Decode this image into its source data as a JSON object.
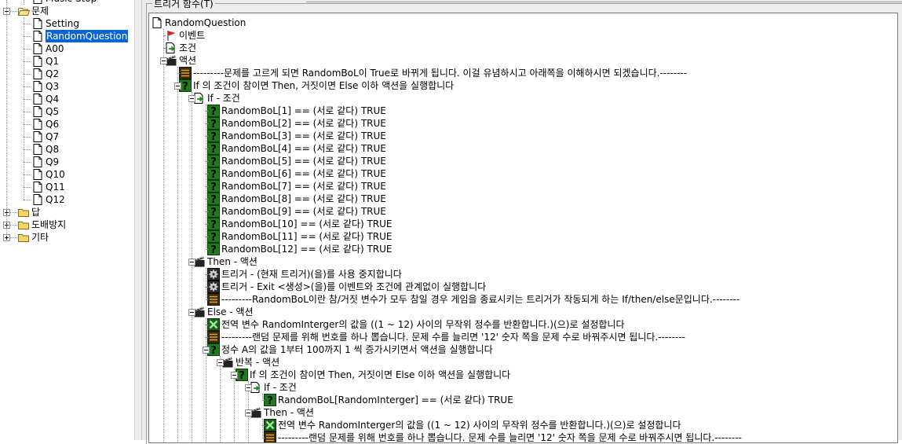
{
  "left_tree": [
    {
      "label": "Music Stop",
      "icon": "page-icon",
      "indent": 2,
      "partial": true
    },
    {
      "label": "문제",
      "icon": "open-folder-icon",
      "indent": 1,
      "expanded": true
    },
    {
      "label": "Setting",
      "icon": "page-icon",
      "indent": 2
    },
    {
      "label": "RandomQuestion",
      "icon": "page-icon",
      "indent": 2,
      "selected": true
    },
    {
      "label": "A00",
      "icon": "page-icon",
      "indent": 2
    },
    {
      "label": "Q1",
      "icon": "page-icon",
      "indent": 2
    },
    {
      "label": "Q2",
      "icon": "page-icon",
      "indent": 2
    },
    {
      "label": "Q3",
      "icon": "page-icon",
      "indent": 2
    },
    {
      "label": "Q4",
      "icon": "page-icon",
      "indent": 2
    },
    {
      "label": "Q5",
      "icon": "page-icon",
      "indent": 2
    },
    {
      "label": "Q6",
      "icon": "page-icon",
      "indent": 2
    },
    {
      "label": "Q7",
      "icon": "page-icon",
      "indent": 2
    },
    {
      "label": "Q8",
      "icon": "page-icon",
      "indent": 2
    },
    {
      "label": "Q9",
      "icon": "page-icon",
      "indent": 2
    },
    {
      "label": "Q10",
      "icon": "page-icon",
      "indent": 2
    },
    {
      "label": "Q11",
      "icon": "page-icon",
      "indent": 2
    },
    {
      "label": "Q12",
      "icon": "page-icon",
      "indent": 2
    },
    {
      "label": "답",
      "icon": "folder-icon",
      "indent": 1,
      "collapsed": true
    },
    {
      "label": "도배방지",
      "icon": "folder-icon",
      "indent": 1,
      "collapsed": true
    },
    {
      "label": "기타",
      "icon": "folder-icon",
      "indent": 1,
      "collapsed": true
    }
  ],
  "panel_title": "트리거 함수(T)",
  "trigger_tree": [
    {
      "label": "RandomQuestion",
      "icon": "page-icon",
      "depth": 0
    },
    {
      "label": "이벤트",
      "icon": "flag-icon",
      "depth": 1
    },
    {
      "label": "조건",
      "icon": "condition-icon",
      "depth": 1
    },
    {
      "label": "액션",
      "icon": "action-icon",
      "depth": 1,
      "toggle": "minus"
    },
    {
      "label": "---------문제를 고르게 되면 RandomBoL이 True로 바뀌게 됩니다. 이걸 유념하시고 아래쪽을 이해하시면 되겠습니다.--------",
      "icon": "comment-icon",
      "depth": 2
    },
    {
      "label": "If 의 조건이 참이면 Then, 거짓이면 Else 이하 액션을 실행합니다",
      "icon": "question-icon",
      "depth": 2,
      "toggle": "minus"
    },
    {
      "label": "If - 조건",
      "icon": "condition-icon",
      "depth": 3,
      "toggle": "minus"
    },
    {
      "label": "RandomBoL[1] == (서로 같다) TRUE",
      "icon": "question-icon",
      "depth": 4
    },
    {
      "label": "RandomBoL[2] == (서로 같다) TRUE",
      "icon": "question-icon",
      "depth": 4
    },
    {
      "label": "RandomBoL[3] == (서로 같다) TRUE",
      "icon": "question-icon",
      "depth": 4
    },
    {
      "label": "RandomBoL[4] == (서로 같다) TRUE",
      "icon": "question-icon",
      "depth": 4
    },
    {
      "label": "RandomBoL[5] == (서로 같다) TRUE",
      "icon": "question-icon",
      "depth": 4
    },
    {
      "label": "RandomBoL[6] == (서로 같다) TRUE",
      "icon": "question-icon",
      "depth": 4
    },
    {
      "label": "RandomBoL[7] == (서로 같다) TRUE",
      "icon": "question-icon",
      "depth": 4
    },
    {
      "label": "RandomBoL[8] == (서로 같다) TRUE",
      "icon": "question-icon",
      "depth": 4
    },
    {
      "label": "RandomBoL[9] == (서로 같다) TRUE",
      "icon": "question-icon",
      "depth": 4
    },
    {
      "label": "RandomBoL[10] == (서로 같다) TRUE",
      "icon": "question-icon",
      "depth": 4
    },
    {
      "label": "RandomBoL[11] == (서로 같다) TRUE",
      "icon": "question-icon",
      "depth": 4
    },
    {
      "label": "RandomBoL[12] == (서로 같다) TRUE",
      "icon": "question-icon",
      "depth": 4
    },
    {
      "label": "Then - 액션",
      "icon": "action-icon",
      "depth": 3,
      "toggle": "minus"
    },
    {
      "label": "트리거 - (현재 트리거)(을)를 사용 중지합니다",
      "icon": "gear-icon",
      "depth": 4
    },
    {
      "label": "트리거 - Exit <생성>(을)를 이벤트와 조건에 관계없이 실행합니다",
      "icon": "gear-icon",
      "depth": 4
    },
    {
      "label": "---------RandomBoL이란 참/거짓 변수가 모두 참일 경우 게임을 종료시키는 트리거가 작동되게 하는 If/then/else문입니다.--------",
      "icon": "comment-icon",
      "depth": 4
    },
    {
      "label": "Else - 액션",
      "icon": "action-icon",
      "depth": 3,
      "toggle": "minus"
    },
    {
      "label": "전역 변수 RandomInterger의 값을 ((1 ~ 12) 사이의 무작위 정수를 반환합니다.)(으)로 설정합니다",
      "icon": "set-variable-icon",
      "depth": 4
    },
    {
      "label": "---------랜덤 문제를 위해 번호를 하나 뽑습니다. 문제 수를 늘리면 '12' 숫자 쪽을 문제 수로 바꿔주시면 됩니다.--------",
      "icon": "comment-icon",
      "depth": 4
    },
    {
      "label": "정수 A의 값을 1부터 100까지 1 씩 증가시키면서 액션을 실행합니다",
      "icon": "question-icon",
      "depth": 4,
      "toggle": "minus"
    },
    {
      "label": "반복 - 액션",
      "icon": "action-icon",
      "depth": 5,
      "toggle": "minus"
    },
    {
      "label": "If 의 조건이 참이면 Then, 거짓이면 Else 이하 액션을 실행합니다",
      "icon": "question-icon",
      "depth": 6,
      "toggle": "minus"
    },
    {
      "label": "If - 조건",
      "icon": "condition-icon",
      "depth": 7,
      "toggle": "minus"
    },
    {
      "label": "RandomBoL[RandomInterger] == (서로 같다) TRUE",
      "icon": "question-icon",
      "depth": 8
    },
    {
      "label": "Then - 액션",
      "icon": "action-icon",
      "depth": 7,
      "toggle": "minus"
    },
    {
      "label": "전역 변수 RandomInterger의 값을 ((1 ~ 12) 사이의 무작위 정수를 반환합니다.)(으)로 설정합니다",
      "icon": "set-variable-icon",
      "depth": 8
    },
    {
      "label": "---------랜덤 문제를 위해 번호를 하나 뽑습니다. 문제 수를 늘리면 '12' 숫자 쪽을 문제 수로 바꿔주시면 됩니다.--------",
      "icon": "comment-icon",
      "depth": 8
    }
  ],
  "colors": {
    "selection": "#0a64d2",
    "panel_bg": "#ececec",
    "question_green": "#1f7a1f",
    "flag_red": "#e02020",
    "folder_yellow": "#f5d66a"
  }
}
